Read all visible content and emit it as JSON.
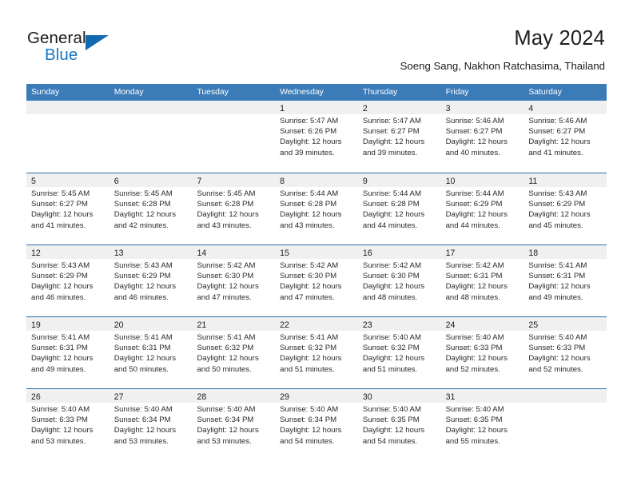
{
  "brand": {
    "name_line1": "General",
    "name_line2": "Blue",
    "accent_color": "#1676c4",
    "triangle_color": "#1169b0"
  },
  "header": {
    "month_title": "May 2024",
    "location": "Soeng Sang, Nakhon Ratchasima, Thailand"
  },
  "theme": {
    "header_row_bg": "#3b7cb8",
    "row_divider": "#2e6da4",
    "daynum_band_bg": "#f0f0f0"
  },
  "weekdays": [
    "Sunday",
    "Monday",
    "Tuesday",
    "Wednesday",
    "Thursday",
    "Friday",
    "Saturday"
  ],
  "weeks": [
    [
      {
        "day": "",
        "sunrise": "",
        "sunset": "",
        "daylight_line1": "",
        "daylight_line2": ""
      },
      {
        "day": "",
        "sunrise": "",
        "sunset": "",
        "daylight_line1": "",
        "daylight_line2": ""
      },
      {
        "day": "",
        "sunrise": "",
        "sunset": "",
        "daylight_line1": "",
        "daylight_line2": ""
      },
      {
        "day": "1",
        "sunrise": "Sunrise: 5:47 AM",
        "sunset": "Sunset: 6:26 PM",
        "daylight_line1": "Daylight: 12 hours",
        "daylight_line2": "and 39 minutes."
      },
      {
        "day": "2",
        "sunrise": "Sunrise: 5:47 AM",
        "sunset": "Sunset: 6:27 PM",
        "daylight_line1": "Daylight: 12 hours",
        "daylight_line2": "and 39 minutes."
      },
      {
        "day": "3",
        "sunrise": "Sunrise: 5:46 AM",
        "sunset": "Sunset: 6:27 PM",
        "daylight_line1": "Daylight: 12 hours",
        "daylight_line2": "and 40 minutes."
      },
      {
        "day": "4",
        "sunrise": "Sunrise: 5:46 AM",
        "sunset": "Sunset: 6:27 PM",
        "daylight_line1": "Daylight: 12 hours",
        "daylight_line2": "and 41 minutes."
      }
    ],
    [
      {
        "day": "5",
        "sunrise": "Sunrise: 5:45 AM",
        "sunset": "Sunset: 6:27 PM",
        "daylight_line1": "Daylight: 12 hours",
        "daylight_line2": "and 41 minutes."
      },
      {
        "day": "6",
        "sunrise": "Sunrise: 5:45 AM",
        "sunset": "Sunset: 6:28 PM",
        "daylight_line1": "Daylight: 12 hours",
        "daylight_line2": "and 42 minutes."
      },
      {
        "day": "7",
        "sunrise": "Sunrise: 5:45 AM",
        "sunset": "Sunset: 6:28 PM",
        "daylight_line1": "Daylight: 12 hours",
        "daylight_line2": "and 43 minutes."
      },
      {
        "day": "8",
        "sunrise": "Sunrise: 5:44 AM",
        "sunset": "Sunset: 6:28 PM",
        "daylight_line1": "Daylight: 12 hours",
        "daylight_line2": "and 43 minutes."
      },
      {
        "day": "9",
        "sunrise": "Sunrise: 5:44 AM",
        "sunset": "Sunset: 6:28 PM",
        "daylight_line1": "Daylight: 12 hours",
        "daylight_line2": "and 44 minutes."
      },
      {
        "day": "10",
        "sunrise": "Sunrise: 5:44 AM",
        "sunset": "Sunset: 6:29 PM",
        "daylight_line1": "Daylight: 12 hours",
        "daylight_line2": "and 44 minutes."
      },
      {
        "day": "11",
        "sunrise": "Sunrise: 5:43 AM",
        "sunset": "Sunset: 6:29 PM",
        "daylight_line1": "Daylight: 12 hours",
        "daylight_line2": "and 45 minutes."
      }
    ],
    [
      {
        "day": "12",
        "sunrise": "Sunrise: 5:43 AM",
        "sunset": "Sunset: 6:29 PM",
        "daylight_line1": "Daylight: 12 hours",
        "daylight_line2": "and 46 minutes."
      },
      {
        "day": "13",
        "sunrise": "Sunrise: 5:43 AM",
        "sunset": "Sunset: 6:29 PM",
        "daylight_line1": "Daylight: 12 hours",
        "daylight_line2": "and 46 minutes."
      },
      {
        "day": "14",
        "sunrise": "Sunrise: 5:42 AM",
        "sunset": "Sunset: 6:30 PM",
        "daylight_line1": "Daylight: 12 hours",
        "daylight_line2": "and 47 minutes."
      },
      {
        "day": "15",
        "sunrise": "Sunrise: 5:42 AM",
        "sunset": "Sunset: 6:30 PM",
        "daylight_line1": "Daylight: 12 hours",
        "daylight_line2": "and 47 minutes."
      },
      {
        "day": "16",
        "sunrise": "Sunrise: 5:42 AM",
        "sunset": "Sunset: 6:30 PM",
        "daylight_line1": "Daylight: 12 hours",
        "daylight_line2": "and 48 minutes."
      },
      {
        "day": "17",
        "sunrise": "Sunrise: 5:42 AM",
        "sunset": "Sunset: 6:31 PM",
        "daylight_line1": "Daylight: 12 hours",
        "daylight_line2": "and 48 minutes."
      },
      {
        "day": "18",
        "sunrise": "Sunrise: 5:41 AM",
        "sunset": "Sunset: 6:31 PM",
        "daylight_line1": "Daylight: 12 hours",
        "daylight_line2": "and 49 minutes."
      }
    ],
    [
      {
        "day": "19",
        "sunrise": "Sunrise: 5:41 AM",
        "sunset": "Sunset: 6:31 PM",
        "daylight_line1": "Daylight: 12 hours",
        "daylight_line2": "and 49 minutes."
      },
      {
        "day": "20",
        "sunrise": "Sunrise: 5:41 AM",
        "sunset": "Sunset: 6:31 PM",
        "daylight_line1": "Daylight: 12 hours",
        "daylight_line2": "and 50 minutes."
      },
      {
        "day": "21",
        "sunrise": "Sunrise: 5:41 AM",
        "sunset": "Sunset: 6:32 PM",
        "daylight_line1": "Daylight: 12 hours",
        "daylight_line2": "and 50 minutes."
      },
      {
        "day": "22",
        "sunrise": "Sunrise: 5:41 AM",
        "sunset": "Sunset: 6:32 PM",
        "daylight_line1": "Daylight: 12 hours",
        "daylight_line2": "and 51 minutes."
      },
      {
        "day": "23",
        "sunrise": "Sunrise: 5:40 AM",
        "sunset": "Sunset: 6:32 PM",
        "daylight_line1": "Daylight: 12 hours",
        "daylight_line2": "and 51 minutes."
      },
      {
        "day": "24",
        "sunrise": "Sunrise: 5:40 AM",
        "sunset": "Sunset: 6:33 PM",
        "daylight_line1": "Daylight: 12 hours",
        "daylight_line2": "and 52 minutes."
      },
      {
        "day": "25",
        "sunrise": "Sunrise: 5:40 AM",
        "sunset": "Sunset: 6:33 PM",
        "daylight_line1": "Daylight: 12 hours",
        "daylight_line2": "and 52 minutes."
      }
    ],
    [
      {
        "day": "26",
        "sunrise": "Sunrise: 5:40 AM",
        "sunset": "Sunset: 6:33 PM",
        "daylight_line1": "Daylight: 12 hours",
        "daylight_line2": "and 53 minutes."
      },
      {
        "day": "27",
        "sunrise": "Sunrise: 5:40 AM",
        "sunset": "Sunset: 6:34 PM",
        "daylight_line1": "Daylight: 12 hours",
        "daylight_line2": "and 53 minutes."
      },
      {
        "day": "28",
        "sunrise": "Sunrise: 5:40 AM",
        "sunset": "Sunset: 6:34 PM",
        "daylight_line1": "Daylight: 12 hours",
        "daylight_line2": "and 53 minutes."
      },
      {
        "day": "29",
        "sunrise": "Sunrise: 5:40 AM",
        "sunset": "Sunset: 6:34 PM",
        "daylight_line1": "Daylight: 12 hours",
        "daylight_line2": "and 54 minutes."
      },
      {
        "day": "30",
        "sunrise": "Sunrise: 5:40 AM",
        "sunset": "Sunset: 6:35 PM",
        "daylight_line1": "Daylight: 12 hours",
        "daylight_line2": "and 54 minutes."
      },
      {
        "day": "31",
        "sunrise": "Sunrise: 5:40 AM",
        "sunset": "Sunset: 6:35 PM",
        "daylight_line1": "Daylight: 12 hours",
        "daylight_line2": "and 55 minutes."
      },
      {
        "day": "",
        "sunrise": "",
        "sunset": "",
        "daylight_line1": "",
        "daylight_line2": ""
      }
    ]
  ]
}
